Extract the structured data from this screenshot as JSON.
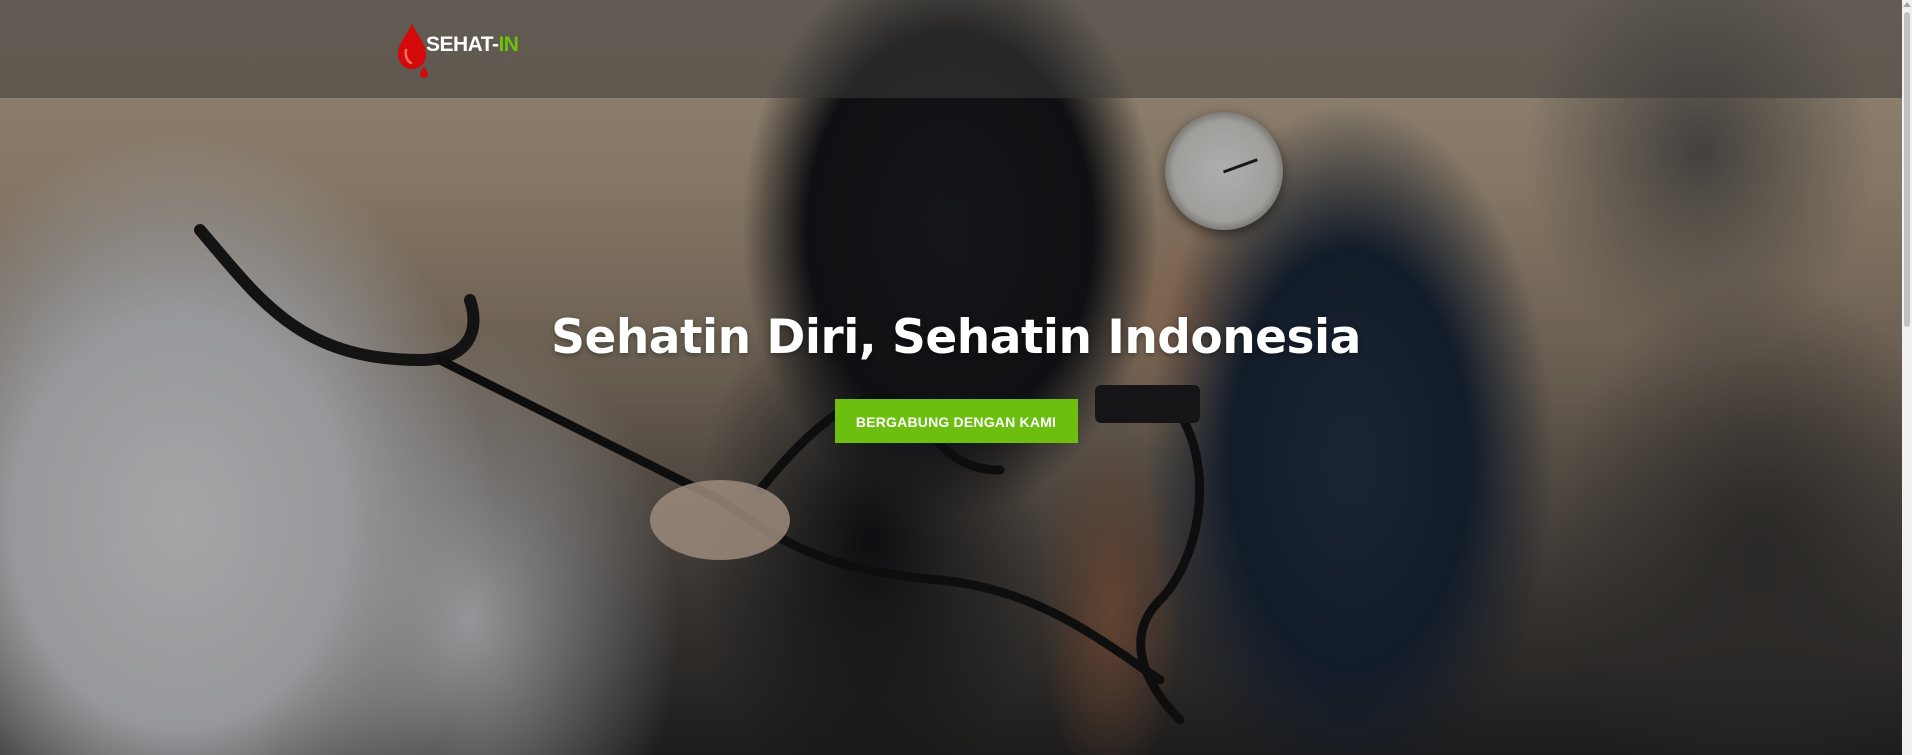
{
  "navbar": {
    "logo": {
      "text_main": "SEHAT-",
      "text_accent": "IN",
      "icon": "blood-drop-icon",
      "accent_color": "#6cc20a",
      "drop_color": "#d40a0a"
    }
  },
  "hero": {
    "title": "Sehatin Diri, Sehatin Indonesia",
    "cta_label": "BERGABUNG DENGAN KAMI",
    "cta_color": "#6cbf0e"
  }
}
